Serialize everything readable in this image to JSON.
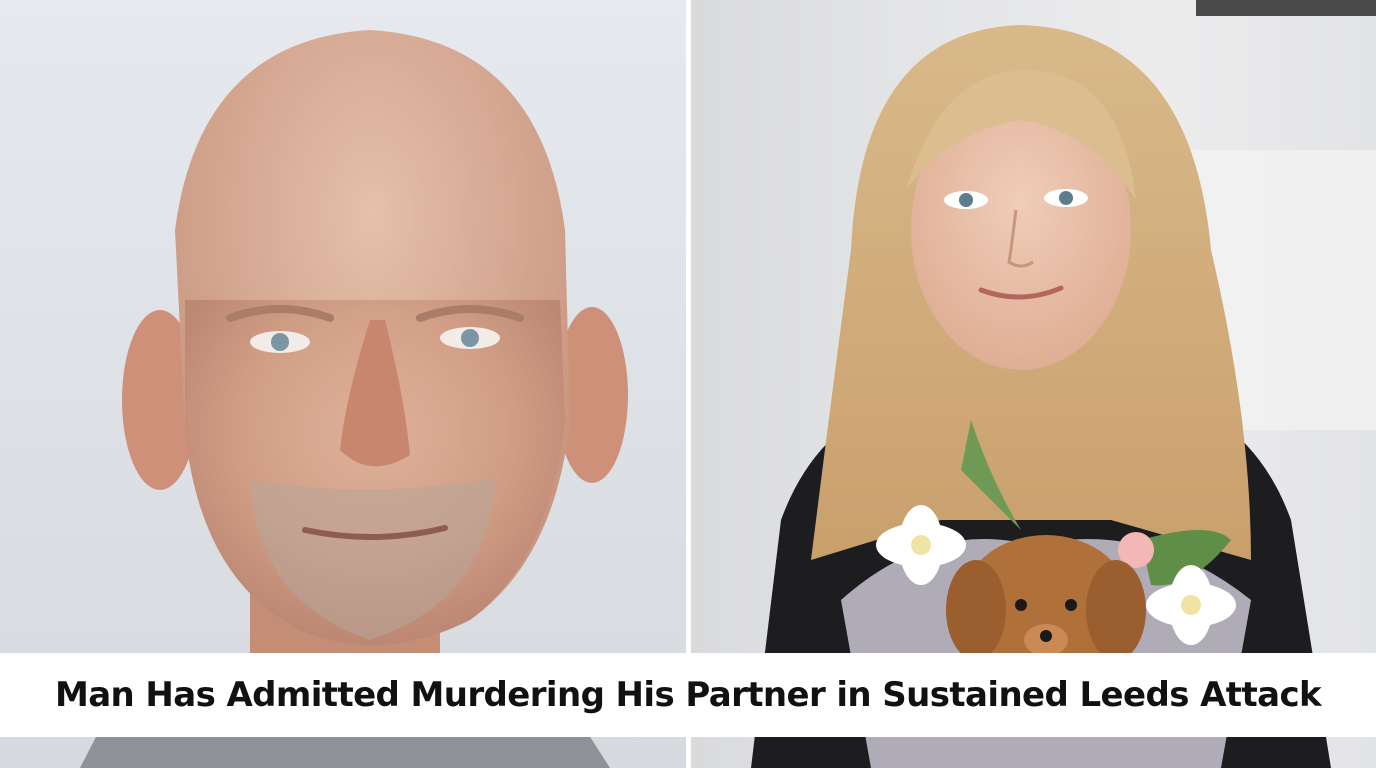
{
  "headline": {
    "text": "Man Has Admitted Murdering His Partner in Sustained Leeds Attack"
  },
  "photos": {
    "left": {
      "subject": "mugshot-man"
    },
    "right": {
      "subject": "woman-with-flowers"
    }
  },
  "colors": {
    "caption_background": "#ffffff",
    "caption_text": "#111111",
    "divider": "#ffffff"
  }
}
